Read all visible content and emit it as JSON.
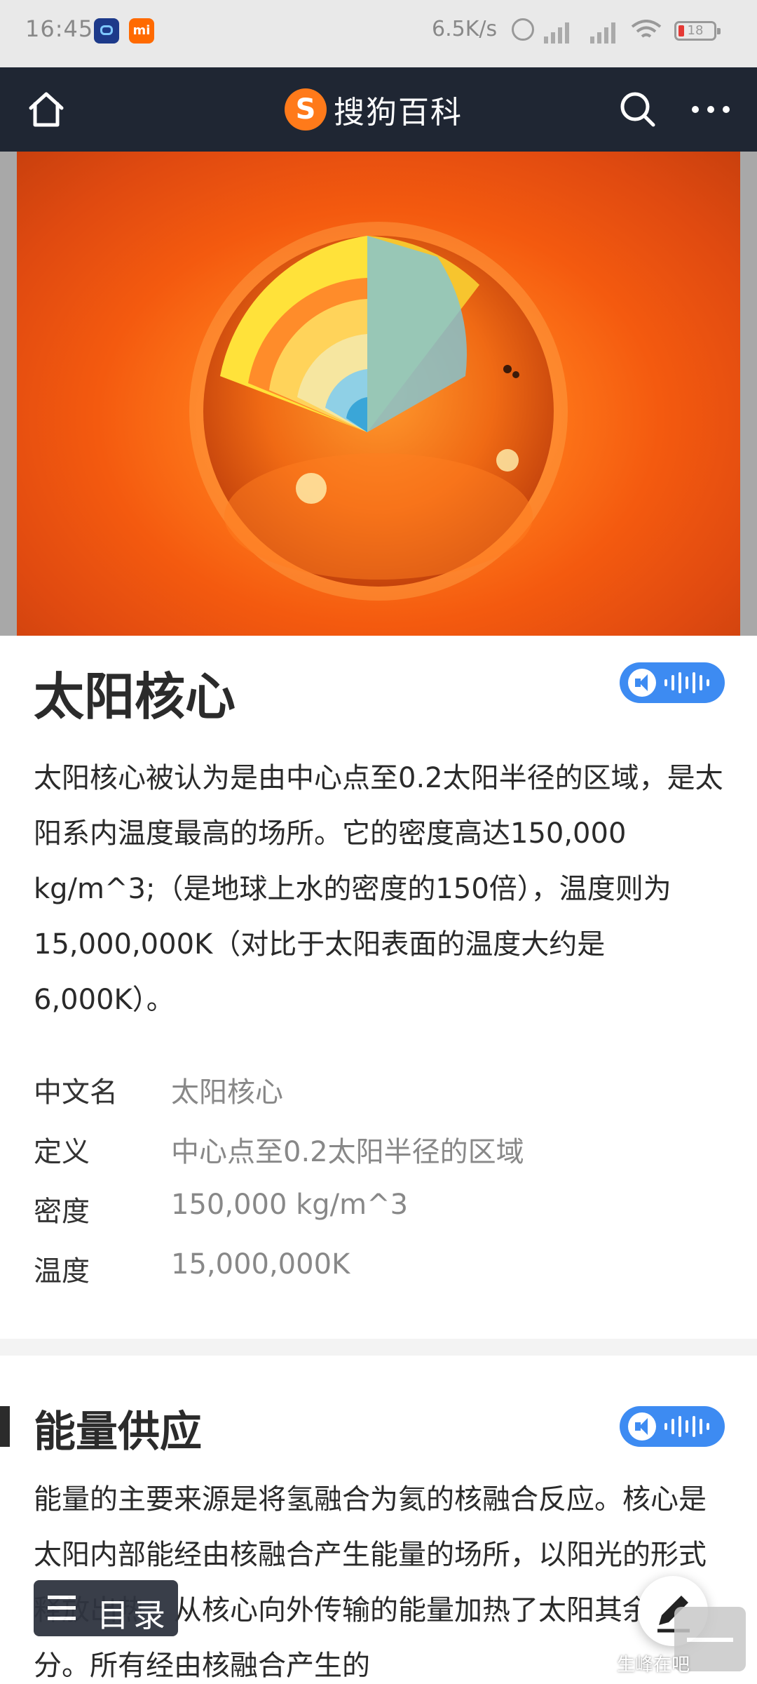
{
  "status_bar": {
    "time": "16:45",
    "net_speed": "6.5K/s",
    "battery": "18",
    "icons": [
      "app-robot-icon",
      "mi-icon",
      "alarm-icon",
      "hd-signal-icon",
      "hd-signal-icon",
      "wifi-icon",
      "battery-icon"
    ],
    "mi_label": "mi"
  },
  "nav": {
    "logo_letter": "S",
    "logo_text": "搜狗百科",
    "icons": [
      "home-icon",
      "search-icon",
      "more-icon"
    ]
  },
  "hero": {
    "subject": "sun-core-cutaway-image"
  },
  "article": {
    "title": "太阳核心",
    "intro": "太阳核心被认为是由中心点至0.2太阳半径的区域，是太阳系内温度最高的场所。它的密度高达150,000 kg/m^3;（是地球上水的密度的150倍），温度则为15,000,000K（对比于太阳表面的温度大约是6,000K）。",
    "infobox": [
      {
        "key": "中文名",
        "value": "太阳核心"
      },
      {
        "key": "定义",
        "value": "中心点至0.2太阳半径的区域"
      },
      {
        "key": "密度",
        "value": "150,000 kg/m^3"
      },
      {
        "key": "温度",
        "value": "15,000,000K"
      }
    ],
    "section": {
      "title": "能量供应",
      "text": "能量的主要来源是将氢融合为氦的核融合反应。核心是太阳内部能经由核融合产生能量的场所，以阳光的形式释放出热：从核心向外传输的能量加热了太阳其余的部分。所有经由核融合产生的"
    }
  },
  "floating": {
    "toc_label": "目录",
    "watermark": "生峰在吧"
  },
  "colors": {
    "nav_bg": "#1f2633",
    "accent_blue": "#3d8bf2",
    "logo_orange": "#ff7a1a",
    "status_bg": "#e9e9e9"
  }
}
